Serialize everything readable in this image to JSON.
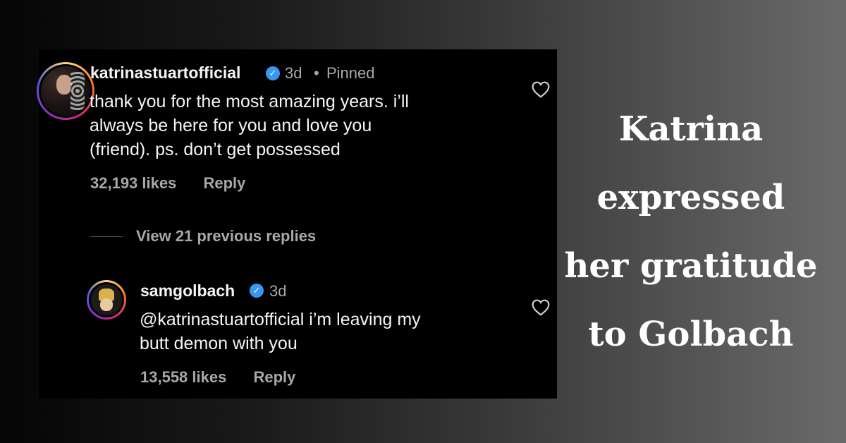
{
  "comments": {
    "first": {
      "username": "katrinastuartofficial",
      "time": "3d",
      "separator": "•",
      "pinned": "Pinned",
      "text": "thank you for the most amazing years. i’ll\nalways be here for you and love you\n(friend). ps. don’t get possessed",
      "likes": "32,193 likes",
      "reply": "Reply"
    },
    "view_replies": "View 21 previous replies",
    "second": {
      "username": "samgolbach",
      "time": "3d",
      "text": "@katrinastuartofficial i’m leaving my\nbutt demon with you",
      "likes": "13,558 likes",
      "reply": "Reply"
    }
  },
  "headline": {
    "line1": "Katrina",
    "line2": "expressed",
    "line3": "her gratitude",
    "line4": "to Golbach"
  },
  "icons": {
    "verified": "verified-badge-icon",
    "heart": "heart-outline-icon"
  },
  "colors": {
    "verified": "#3897f0",
    "panel": "#000000",
    "muted_text": "#a8a8a8"
  }
}
